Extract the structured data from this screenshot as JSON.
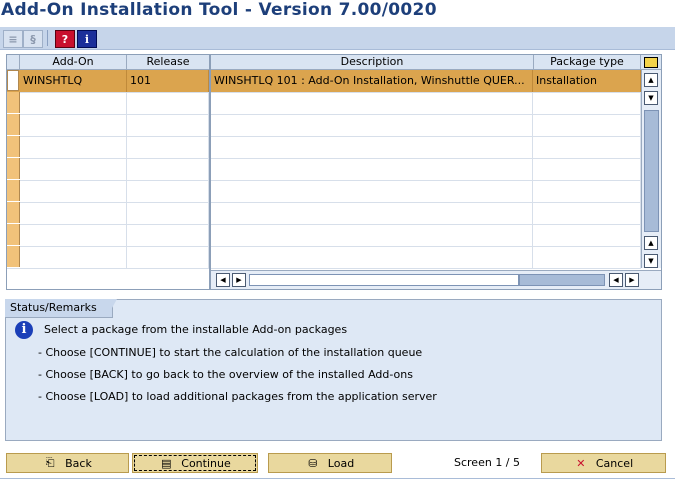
{
  "window": {
    "title": "Add-On Installation Tool - Version 7.00/0020"
  },
  "toolbar": {
    "icons": [
      "execute-icon",
      "execute-alt-icon",
      "help-icon",
      "info-icon"
    ],
    "help_glyph": "?",
    "info_glyph": "i"
  },
  "left_table": {
    "headers": [
      "Add-On",
      "Release"
    ],
    "rows": [
      {
        "addon": "WINSHTLQ",
        "release": "101"
      }
    ]
  },
  "right_table": {
    "headers": [
      "Description",
      "Package type"
    ],
    "rows": [
      {
        "description": "WINSHTLQ 101 : Add-On Installation, Winshuttle QUER...",
        "package_type": "Installation"
      }
    ]
  },
  "status": {
    "tab_label": "Status/Remarks",
    "lines": [
      "Select a package from the installable Add-on packages",
      "- Choose [CONTINUE] to start the calculation of the installation queue",
      "- Choose [BACK] to go back to the overview of the installed Add-ons",
      "- Choose [LOAD] to load additional packages from the application server"
    ]
  },
  "buttons": {
    "back": "Back",
    "continue": "Continue",
    "load": "Load",
    "cancel": "Cancel"
  },
  "screen_indicator": "Screen 1 / 5"
}
